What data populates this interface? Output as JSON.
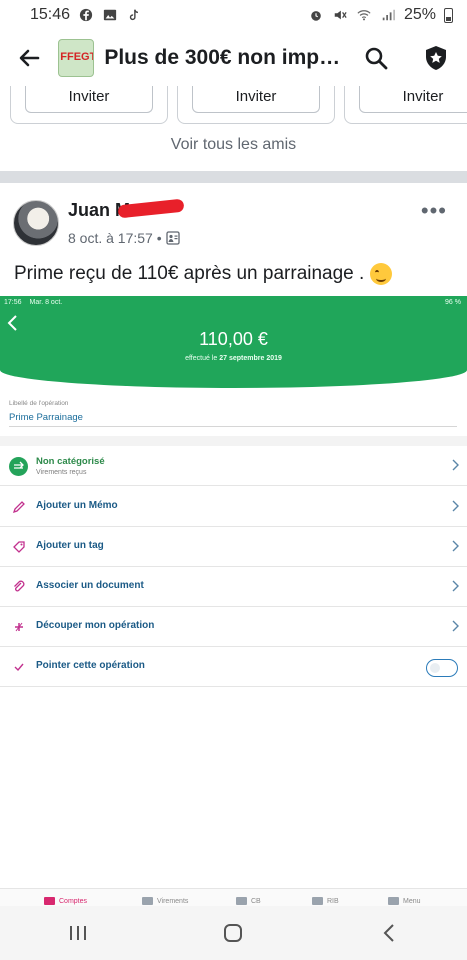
{
  "status_bar": {
    "time": "15:46",
    "battery": "25%",
    "left_icons": [
      "facebook-icon",
      "gallery-icon",
      "tiktok-icon"
    ],
    "right_icons": [
      "alarm-icon",
      "mute-icon",
      "wifi-icon",
      "signal-icon",
      "battery-icon"
    ]
  },
  "header": {
    "title": "Plus de 300€ non impo...",
    "group_logo_text": "FFEGT"
  },
  "invite": {
    "buttons": [
      "Inviter",
      "Inviter",
      "Inviter"
    ],
    "see_all": "Voir tous les amis"
  },
  "post": {
    "author": "Juan M",
    "date": "8 oct. à 17:57 •",
    "text": "Prime reçu de 110€ après un parrainage .",
    "more": "•••"
  },
  "screenshot": {
    "status_time": "17:56",
    "status_date": "Mar. 8 oct.",
    "status_right": "96 %",
    "amount": "110,00 €",
    "amount_sub_prefix": "effectué le",
    "amount_sub_date": "27 septembre 2019",
    "libelle_label": "Libellé de l'opération",
    "libelle_value": "Prime Parrainage",
    "category": {
      "label": "Non catégorisé",
      "sub": "Virements reçus"
    },
    "actions": [
      {
        "label": "Ajouter un Mémo",
        "icon": "pencil-icon"
      },
      {
        "label": "Ajouter un tag",
        "icon": "tag-icon"
      },
      {
        "label": "Associer un document",
        "icon": "paperclip-icon"
      },
      {
        "label": "Découper mon opération",
        "icon": "split-icon"
      },
      {
        "label": "Pointer cette opération",
        "icon": "check-icon"
      }
    ],
    "tabs": [
      "Comptes",
      "Virements",
      "CB",
      "RIB",
      "Menu"
    ]
  },
  "colors": {
    "accent_green": "#20a65a",
    "link_blue": "#1b5a86",
    "pink": "#d8286f"
  }
}
